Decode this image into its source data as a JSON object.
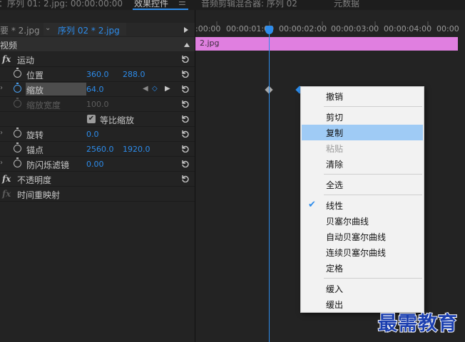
{
  "tabs": {
    "source": "：序列 01: 2.jpg: 00:00:00:00",
    "effect_controls": "效果控件",
    "menu_glyph": "☰",
    "audio_mixer": "音频剪辑混合器: 序列 02",
    "metadata": "元数据"
  },
  "clip_tabs": {
    "master": "要 * 2.jpg",
    "sequence_chevron": "⌄",
    "sequence": "序列 02 * 2.jpg"
  },
  "section": {
    "label": "视频"
  },
  "effects": {
    "fx_symbol": "fx",
    "motion": {
      "label": "运动"
    },
    "position": {
      "label": "位置",
      "x": "360.0",
      "y": "288.0"
    },
    "scale": {
      "label": "缩放",
      "value": "64.0"
    },
    "scale_width": {
      "label": "缩放宽度",
      "value": "100.0"
    },
    "uniform_scale": {
      "label": "等比缩放",
      "check": "✔"
    },
    "rotation": {
      "label": "旋转",
      "value": "0.0"
    },
    "anchor": {
      "label": "锚点",
      "x": "2560.0",
      "y": "1920.0"
    },
    "flicker": {
      "label": "防闪烁滤镜",
      "value": "0.00"
    },
    "opacity": {
      "label": "不透明度"
    },
    "time_remap": {
      "label": "时间重映射"
    },
    "expander": "›"
  },
  "timeline": {
    "ruler": [
      ":00:00",
      "00:00:01:00",
      "00:00:02:00",
      "00:00:03:00",
      "00:00:04:00",
      "00:00"
    ],
    "clip": "2.jpg",
    "clip_color": "#e07fe0",
    "accent": "#2d8ceb"
  },
  "context_menu": {
    "undo": "撤销",
    "cut": "剪切",
    "copy": "复制",
    "paste": "粘贴",
    "clear": "清除",
    "select_all": "全选",
    "linear": "线性",
    "linear_check": "✔",
    "bezier": "贝塞尔曲线",
    "auto_bezier": "自动贝塞尔曲线",
    "continuous_bezier": "连续贝塞尔曲线",
    "hold": "定格",
    "ease_in": "缓入",
    "ease_out": "缓出"
  },
  "watermark": "最需教育"
}
